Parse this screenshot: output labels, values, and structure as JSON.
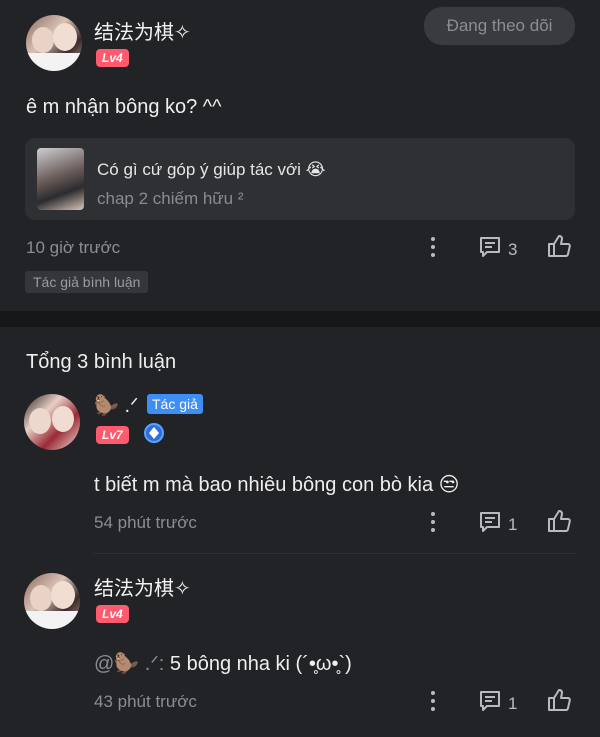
{
  "post": {
    "author_name": "结法为棋✧",
    "level": "Lv4",
    "follow_label": "Đang theo dõi",
    "text": "ê m nhận bông ko? ^^",
    "quote": {
      "title": "Có gì cứ góp ý giúp tác với 😭",
      "subtitle": "chap 2 chiếm hữu ²"
    },
    "time": "10 giờ trước",
    "comment_count": "3",
    "tag": "Tác giả bình luận"
  },
  "comments_section": {
    "title": "Tổng 3 bình luận"
  },
  "comments": [
    {
      "author_name": "🦫 .ᐟ",
      "badge": "Tác giả",
      "level": "Lv7",
      "text": "t biết m mà bao nhiêu bông con bò kia 😒",
      "time": "54 phút trước",
      "reply_count": "1"
    },
    {
      "author_name": "结法为棋✧",
      "level": "Lv4",
      "mention": "@🦫 .ᐟ:",
      "text": " 5 bông nha ki (´•̥ω•̥`)",
      "time": "43 phút trước",
      "reply_count": "1"
    }
  ],
  "colors": {
    "background": "#222326",
    "level_badge": "#ff5a6e",
    "author_badge": "#3f8ef5"
  }
}
